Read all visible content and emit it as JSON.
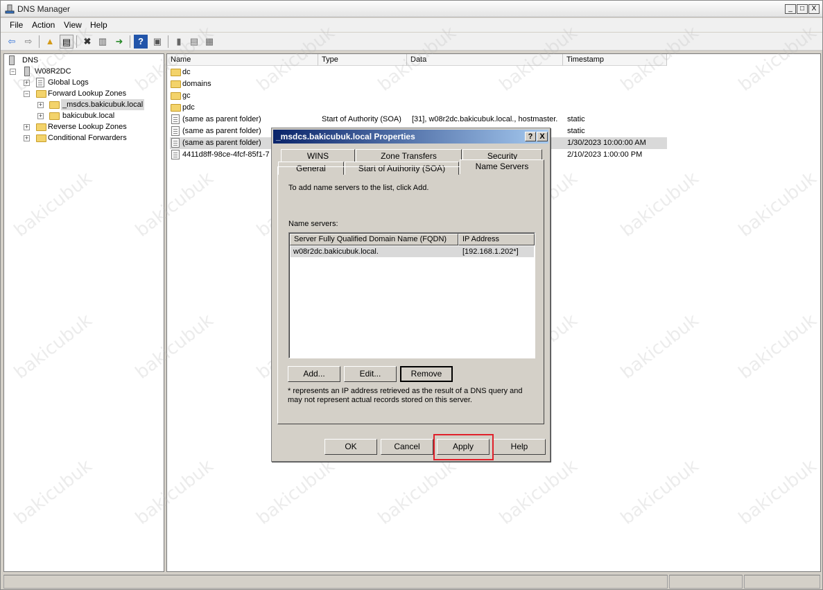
{
  "window": {
    "title": "DNS Manager",
    "controls": [
      "_",
      "□",
      "X"
    ]
  },
  "menu": [
    "File",
    "Action",
    "View",
    "Help"
  ],
  "toolbar": {
    "buttons": [
      "back-icon",
      "forward-icon",
      "up-folder-icon",
      "show-hide-tree-icon",
      "delete-icon",
      "properties-icon",
      "export-icon",
      "help-icon",
      "console-icon",
      "server-icon",
      "records-icon",
      "refresh-icon"
    ]
  },
  "tree": {
    "items": [
      {
        "label": "DNS"
      },
      {
        "label": "W08R2DC"
      },
      {
        "label": "Global Logs"
      },
      {
        "label": "Forward Lookup Zones"
      },
      {
        "label": "_msdcs.bakicubuk.local"
      },
      {
        "label": "bakicubuk.local"
      },
      {
        "label": "Reverse Lookup Zones"
      },
      {
        "label": "Conditional Forwarders"
      }
    ]
  },
  "list": {
    "columns": [
      "Name",
      "Type",
      "Data",
      "Timestamp"
    ],
    "rows": [
      {
        "name": "dc",
        "type": "",
        "data": "",
        "timestamp": ""
      },
      {
        "name": "domains",
        "type": "",
        "data": "",
        "timestamp": ""
      },
      {
        "name": "gc",
        "type": "",
        "data": "",
        "timestamp": ""
      },
      {
        "name": "pdc",
        "type": "",
        "data": "",
        "timestamp": ""
      },
      {
        "name": "(same as parent folder)",
        "type": "Start of Authority (SOA)",
        "data": "[31], w08r2dc.bakicubuk.local., hostmaster.",
        "timestamp": "static"
      },
      {
        "name": "(same as parent folder)",
        "type": "",
        "data": "",
        "timestamp": "static"
      },
      {
        "name": "(same as parent folder)",
        "type": "",
        "data": "",
        "timestamp": "1/30/2023 10:00:00 AM"
      },
      {
        "name": "4411d8ff-98ce-4fcf-85f1-7",
        "type": "",
        "data": "",
        "timestamp": "2/10/2023 1:00:00 PM"
      }
    ]
  },
  "watermark": "bakicubuk",
  "dialog": {
    "title": "_msdcs.bakicubuk.local Properties",
    "help_btn": "?",
    "close_btn": "X",
    "tabs_back": [
      "WINS",
      "Zone Transfers",
      "Security"
    ],
    "tabs_front": [
      "General",
      "Start of Authority (SOA)",
      "Name Servers"
    ],
    "instruction": "To add name servers to the list, click Add.",
    "name_servers_label": "Name servers:",
    "ns_columns": [
      "Server Fully Qualified Domain Name (FQDN)",
      "IP Address"
    ],
    "ns_rows": [
      {
        "fqdn": "w08r2dc.bakicubuk.local.",
        "ip": "[192.168.1.202*]"
      }
    ],
    "add_btn": "Add...",
    "edit_btn": "Edit...",
    "remove_btn": "Remove",
    "note": "* represents an IP address retrieved as the result of a DNS query and may not represent actual records stored on this server.",
    "ok_btn": "OK",
    "cancel_btn": "Cancel",
    "apply_btn": "Apply",
    "help_button": "Help"
  },
  "colors": {
    "dialog_title_start": "#0a246a",
    "dialog_title_end": "#a6caf0",
    "highlight": "#e0202a",
    "selection": "#d9d9d9"
  }
}
